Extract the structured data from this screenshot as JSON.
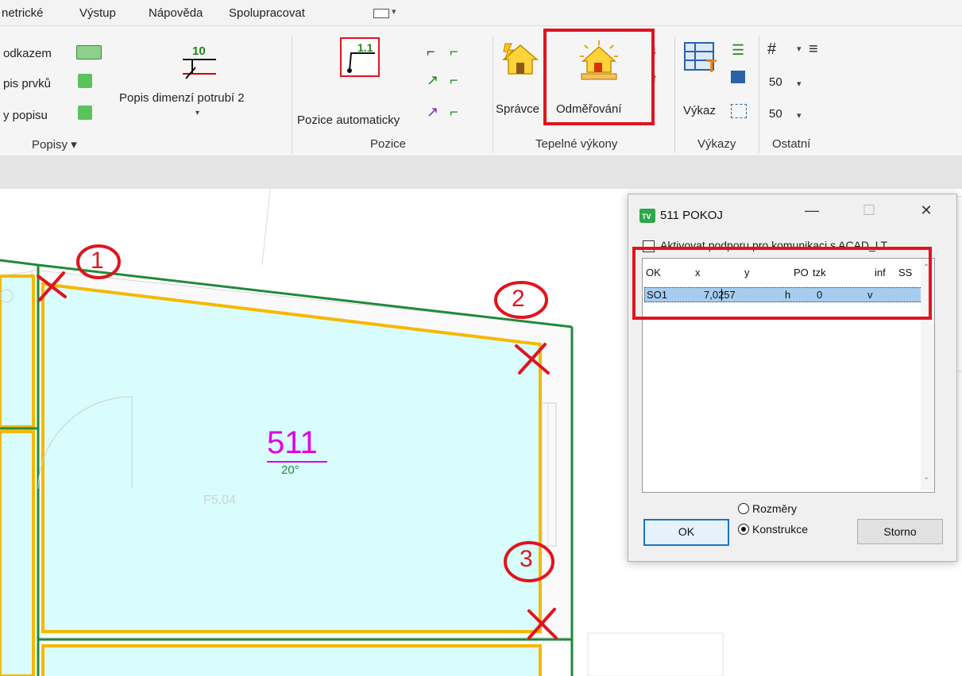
{
  "menu": [
    "netrické",
    "Výstup",
    "Nápověda",
    "Spolupracovat"
  ],
  "ribbon": {
    "popisy": {
      "items": [
        "odkazem",
        "pis prvků",
        "y popisu"
      ],
      "big_label": "Popis dimenzí potrubí 2",
      "big_icon_number": "10",
      "group_label": "Popisy ▾"
    },
    "pozice": {
      "big_label": "Pozice automaticky",
      "big_icon_number": "1.1",
      "group_label": "Pozice"
    },
    "tepelne": {
      "spravce_label": "Správce",
      "odmerovani_label": "Odměřování",
      "group_label": "Tepelné výkony"
    },
    "vykazy": {
      "vykaz_label": "Výkaz",
      "group_label": "Výkazy"
    },
    "ostatni": {
      "val1": "50",
      "val2": "50",
      "group_label": "Ostatní"
    }
  },
  "drawing": {
    "room_number": "511",
    "temperature": "20°",
    "room_code": "F5.04",
    "markers": [
      "1",
      "2",
      "3"
    ]
  },
  "dialog": {
    "title": "511 POKOJ",
    "app_badge": "TV",
    "minimize": "—",
    "maximize": "☐",
    "close": "✕",
    "checkbox_label": "Aktivovat podporu pro komunikaci s ACAD_LT",
    "headers": [
      "OK",
      "x",
      "y",
      "PO",
      "tzk",
      "inf",
      "SS"
    ],
    "row": {
      "ok": "SO1",
      "x": "7,0257",
      "po": "h",
      "tzk": "0",
      "inf": "v"
    },
    "radio_rozmery": "Rozměry",
    "radio_konstrukce": "Konstrukce",
    "ok_button": "OK",
    "cancel_button": "Storno"
  },
  "colors": {
    "room_fill": "#d9fcfc",
    "room_outline": "#f5b800",
    "wall": "#1f8a3a",
    "room_number": "#e000e0",
    "annotation": "#e0141e"
  }
}
